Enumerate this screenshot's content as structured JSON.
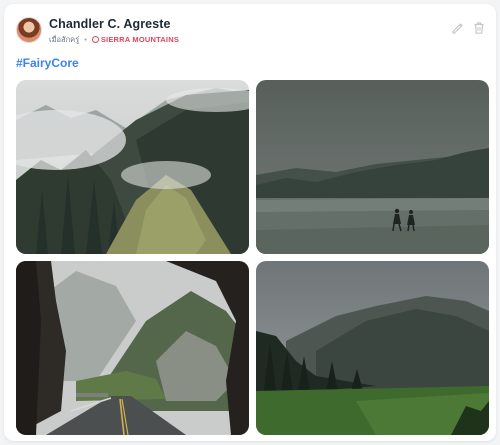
{
  "post": {
    "author_name": "Chandler C. Agreste",
    "time_label": "เมื่อสักครู่",
    "location": "SIERRA MOUNTAINS",
    "hashtag": "#FairyCore"
  },
  "actions": {
    "edit_icon": "pencil-icon",
    "delete_icon": "trash-icon"
  },
  "colors": {
    "hashtag": "#3b82f6",
    "location": "#e0445b",
    "icon": "#c4c8ce"
  },
  "images": [
    {
      "name": "photo-misty-ridge",
      "subject": "misty forested mountain ridge"
    },
    {
      "name": "photo-field-couple",
      "subject": "two people walking in foggy field"
    },
    {
      "name": "photo-canyon-road",
      "subject": "wet road through rocky canyon"
    },
    {
      "name": "photo-mountain-meadow",
      "subject": "dark mountain over green meadow"
    }
  ]
}
